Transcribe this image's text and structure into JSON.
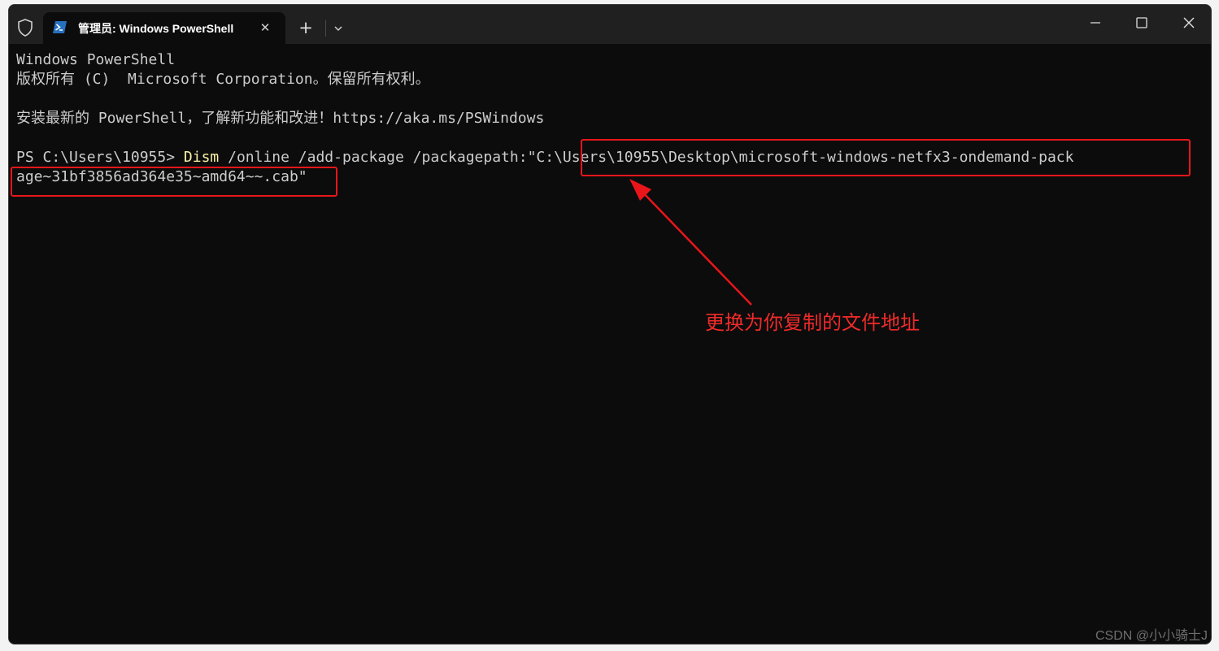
{
  "window": {
    "tab_title": "管理员: Windows PowerShell",
    "tab_icon": "powershell-icon",
    "shield_icon": "shield-icon"
  },
  "colors": {
    "terminal_bg": "#0c0c0c",
    "titlebar_bg": "#202020",
    "text": "#cccccc",
    "command_highlight": "#f9f1a5",
    "annotation_red": "#e8161b"
  },
  "terminal": {
    "line1": "Windows PowerShell",
    "line2": "版权所有 (C)  Microsoft Corporation。保留所有权利。",
    "line3": "安装最新的 PowerShell，了解新功能和改进！https://aka.ms/PSWindows",
    "prompt": "PS C:\\Users\\10955> ",
    "command": "Dism",
    "args": " /online /add-package /packagepath:",
    "path_part1": "\"C:\\Users\\10955\\Desktop\\microsoft-windows-netfx3-ondemand-pack",
    "path_part2": "age~31bf3856ad364e35~amd64~~.cab\""
  },
  "annotation": {
    "text": "更换为你复制的文件地址"
  },
  "watermark": "CSDN @小小骑士J"
}
